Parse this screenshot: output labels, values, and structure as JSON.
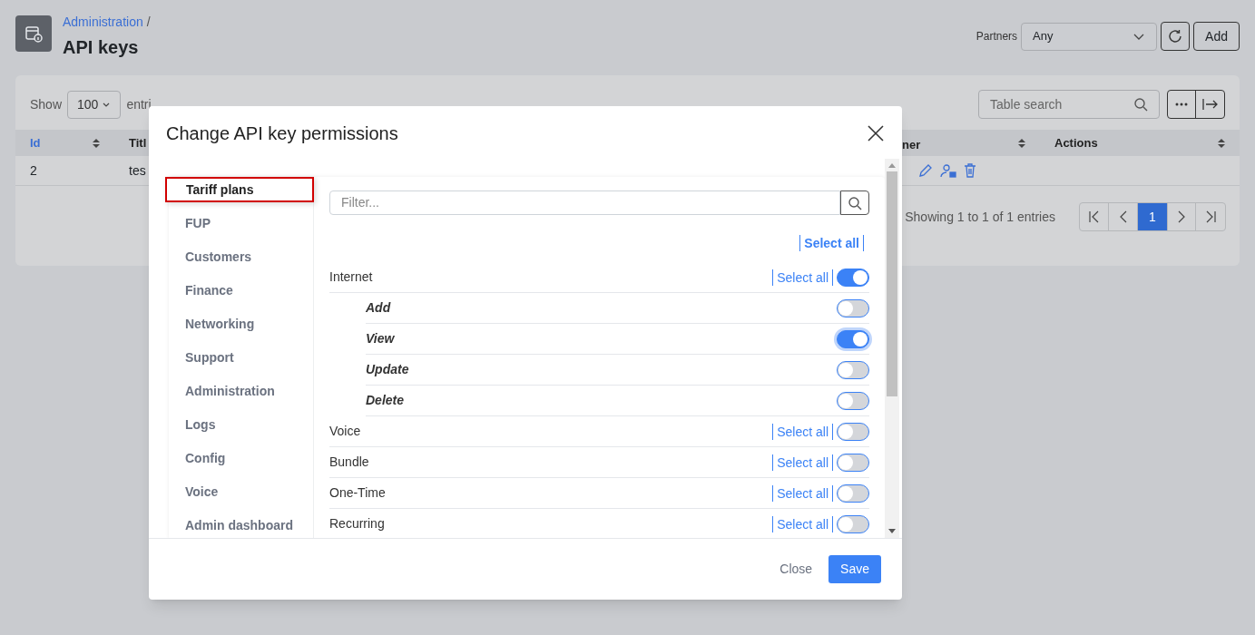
{
  "page": {
    "breadcrumb": "Administration",
    "separator": "/",
    "title": "API keys"
  },
  "toolbar": {
    "partners_label": "Partners",
    "partners_value": "Any",
    "add_button": "Add"
  },
  "table_controls": {
    "show_label": "Show",
    "page_size": "100",
    "entries_label": "entri",
    "search_placeholder": "Table search"
  },
  "table": {
    "columns": [
      {
        "label": "Id",
        "sorted": true
      },
      {
        "label": "Titl",
        "sorted": false
      },
      {
        "label": "ner",
        "sorted": false
      },
      {
        "label": "Actions",
        "sorted": false
      }
    ],
    "rows": [
      {
        "cells": [
          "2",
          "tes"
        ]
      }
    ]
  },
  "pagination": {
    "info": "Showing 1 to 1 of 1 entries",
    "pages": [
      {
        "label": "1",
        "selected": true
      }
    ]
  },
  "dialog": {
    "title": "Change API key permissions",
    "nav": [
      {
        "label": "Tariff plans",
        "selected": true
      },
      {
        "label": "FUP",
        "selected": false
      },
      {
        "label": "Customers",
        "selected": false
      },
      {
        "label": "Finance",
        "selected": false
      },
      {
        "label": "Networking",
        "selected": false
      },
      {
        "label": "Support",
        "selected": false
      },
      {
        "label": "Administration",
        "selected": false
      },
      {
        "label": "Logs",
        "selected": false
      },
      {
        "label": "Config",
        "selected": false
      },
      {
        "label": "Voice",
        "selected": false
      },
      {
        "label": "Admin dashboard",
        "selected": false
      }
    ],
    "filter_placeholder": "Filter...",
    "select_all_top": "Select all",
    "groups": [
      {
        "label": "Internet",
        "select_all": "Select all",
        "on": true,
        "children": [
          {
            "label": "Add",
            "on": false,
            "focused": false
          },
          {
            "label": "View",
            "on": true,
            "focused": true
          },
          {
            "label": "Update",
            "on": false,
            "focused": false
          },
          {
            "label": "Delete",
            "on": false,
            "focused": false
          }
        ]
      },
      {
        "label": "Voice",
        "select_all": "Select all",
        "on": false
      },
      {
        "label": "Bundle",
        "select_all": "Select all",
        "on": false
      },
      {
        "label": "One-Time",
        "select_all": "Select all",
        "on": false
      },
      {
        "label": "Recurring",
        "select_all": "Select all",
        "on": false
      }
    ],
    "buttons": {
      "close": "Close",
      "save": "Save"
    }
  }
}
